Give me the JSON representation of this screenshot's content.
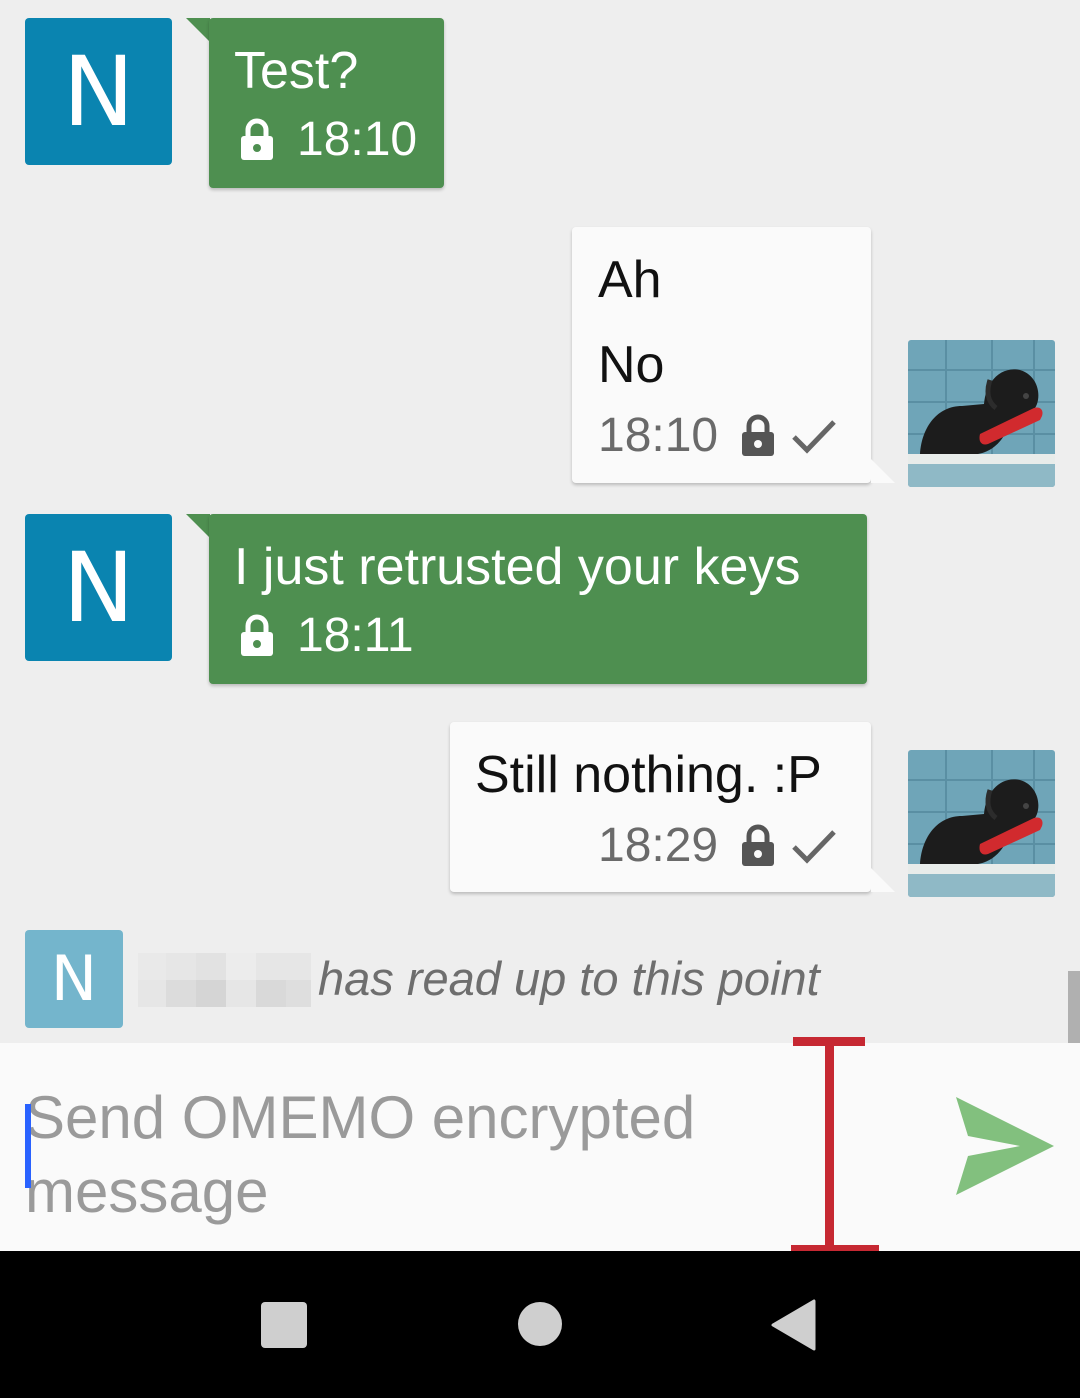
{
  "messages": [
    {
      "direction": "received",
      "avatar_letter": "N",
      "lines": [
        "Test?"
      ],
      "time": "18:10",
      "encrypted": true
    },
    {
      "direction": "sent",
      "lines": [
        "Ah",
        "No"
      ],
      "time": "18:10",
      "encrypted": true,
      "delivered": true
    },
    {
      "direction": "received",
      "avatar_letter": "N",
      "lines": [
        "I just retrusted your keys"
      ],
      "time": "18:11",
      "encrypted": true
    },
    {
      "direction": "sent",
      "lines": [
        "Still nothing. :P"
      ],
      "time": "18:29",
      "encrypted": true,
      "delivered": true
    }
  ],
  "read_marker": {
    "avatar_letter": "N",
    "text": "has read up to this point"
  },
  "composer": {
    "placeholder": "Send OMEMO encrypted message"
  },
  "colors": {
    "received_bubble": "#4e8f50",
    "sent_bubble": "#fafafa",
    "avatar": "#0a84b0",
    "avatar_faded": "#74b5cc",
    "send_icon": "#82c07e",
    "text_cursor": "#c62832",
    "input_caret": "#2962ff"
  },
  "icons": {
    "encryption": "lock-icon",
    "delivery": "check-icon",
    "send": "send-icon",
    "nav_recents": "square-icon",
    "nav_home": "circle-icon",
    "nav_back": "triangle-back-icon"
  }
}
